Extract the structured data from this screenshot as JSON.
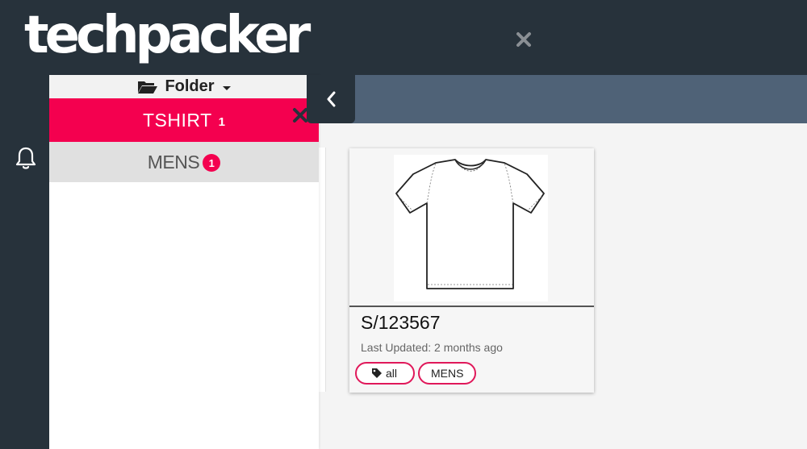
{
  "header": {
    "logo_text": "techpacker",
    "close_icon": "close-icon"
  },
  "rail": {
    "notifications_icon": "bell-icon"
  },
  "folder_panel": {
    "title": "Folder",
    "folder_icon": "folder-open-icon",
    "items": [
      {
        "label": "TSHIRT",
        "count": "1",
        "state": "active"
      },
      {
        "label": "MENS",
        "count": "1",
        "state": "normal"
      }
    ]
  },
  "collapse_toggle": {
    "icon": "chevron-left-icon"
  },
  "products": [
    {
      "sku": "S/123567",
      "updated": "Last Updated: 2 months ago",
      "tags": [
        "all",
        "MENS"
      ]
    }
  ],
  "colors": {
    "dark": "#27323b",
    "accent": "#f4004f",
    "band": "#4f6277"
  }
}
